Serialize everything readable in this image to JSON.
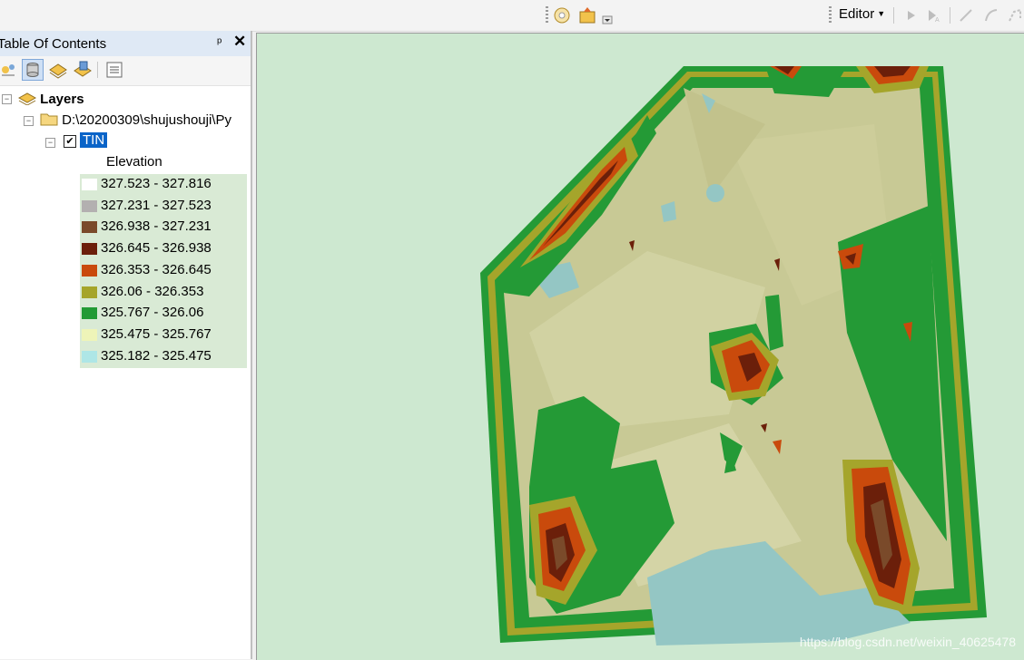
{
  "toolbar": {
    "editor_label": "Editor"
  },
  "toc": {
    "title": "Table Of Contents",
    "pin_glyph": "ᵖ",
    "close_glyph": "✕",
    "layers_label": "Layers",
    "path_label": "D:\\20200309\\shujushouji\\Py",
    "layer_name": "TIN",
    "layer_checked": true,
    "field_label": "Elevation",
    "legend": [
      {
        "label": "327.523 - 327.816",
        "color": "#ffffff"
      },
      {
        "label": "327.231 - 327.523",
        "color": "#b3b0b0"
      },
      {
        "label": "326.938 - 327.231",
        "color": "#7a4a2a"
      },
      {
        "label": "326.645 - 326.938",
        "color": "#6b1f0a"
      },
      {
        "label": "326.353 - 326.645",
        "color": "#c94a0c"
      },
      {
        "label": "326.06 - 326.353",
        "color": "#a5a52a"
      },
      {
        "label": "325.767 - 326.06",
        "color": "#229a34"
      },
      {
        "label": "325.475 - 325.767",
        "color": "#eef4b8"
      },
      {
        "label": "325.182 - 325.475",
        "color": "#aee6e6"
      }
    ]
  },
  "map": {
    "background_color": "#cde8d0",
    "watermark": "https://blog.csdn.net/weixin_40625478"
  }
}
